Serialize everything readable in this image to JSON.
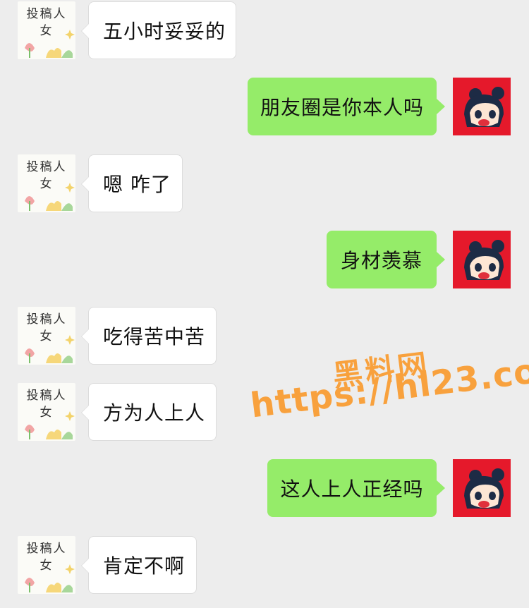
{
  "avatars": {
    "sender_text_line1": "投稿人",
    "sender_text_line2": "女"
  },
  "messages": [
    {
      "side": "left",
      "text": "五小时妥妥的"
    },
    {
      "side": "right",
      "text": "朋友圈是你本人吗"
    },
    {
      "side": "left",
      "text": "嗯 咋了"
    },
    {
      "side": "right",
      "text": "身材羡慕"
    },
    {
      "side": "left",
      "text": "吃得苦中苦"
    },
    {
      "side": "left",
      "text": "方为人上人"
    },
    {
      "side": "right",
      "text": "这人上人正经吗"
    },
    {
      "side": "left",
      "text": "肯定不啊"
    }
  ],
  "watermark": {
    "title": "黑料网",
    "url": "https://hl23.co"
  },
  "colors": {
    "background": "#ededed",
    "self_bubble": "#95ec69",
    "other_bubble": "#ffffff",
    "watermark": "#f8a13d"
  }
}
